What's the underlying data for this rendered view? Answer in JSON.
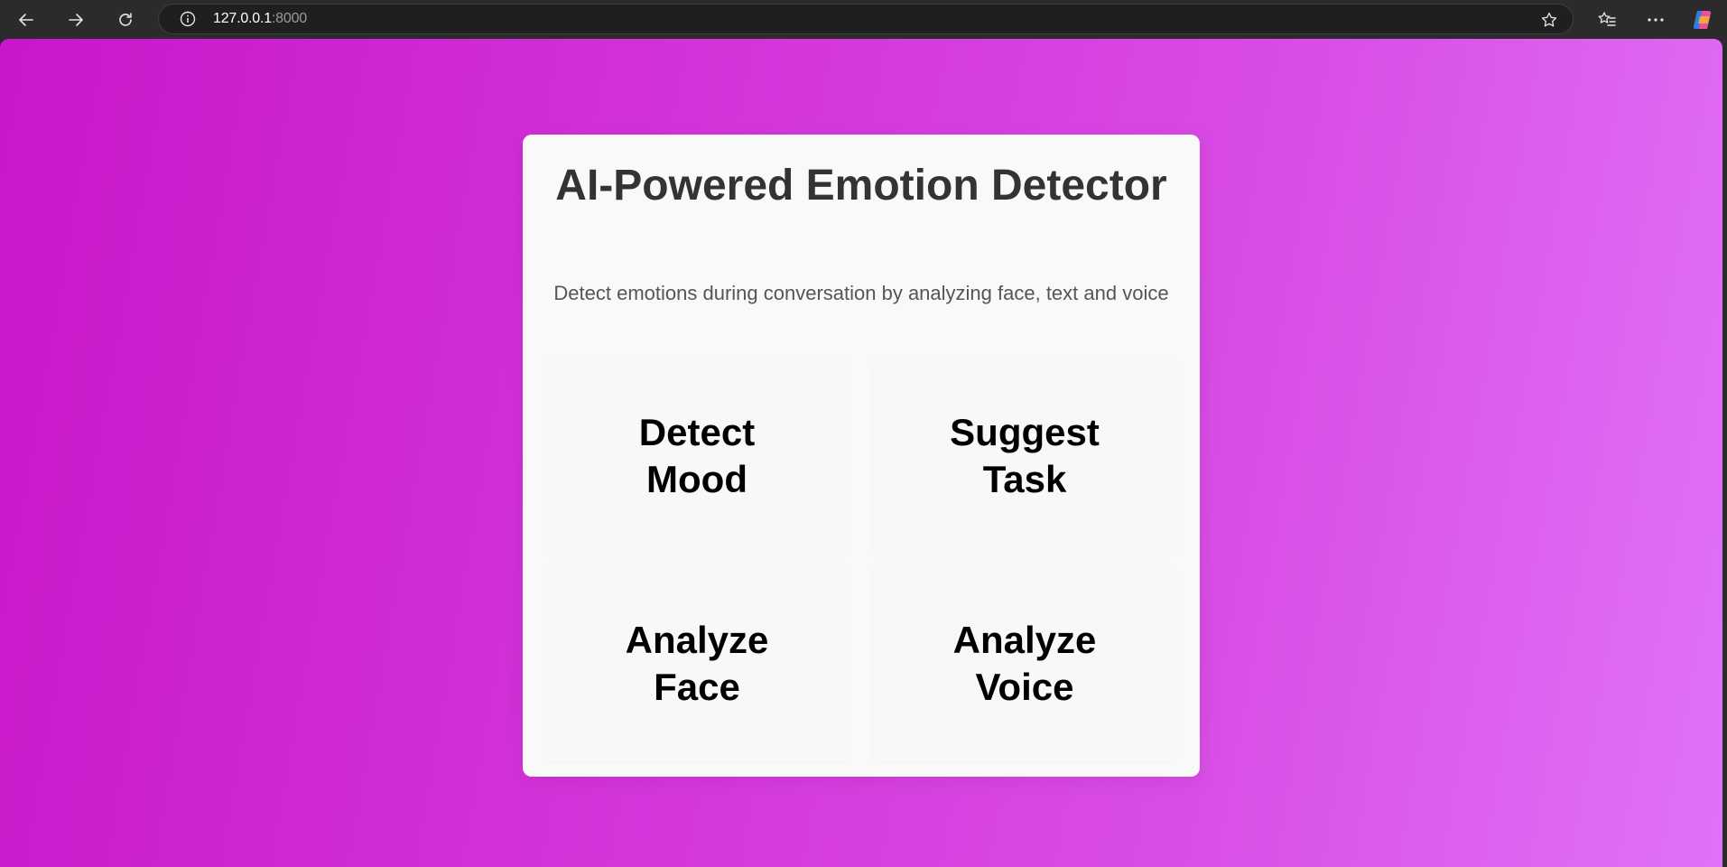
{
  "browser": {
    "url_host": "127.0.0.1",
    "url_port": ":8000"
  },
  "main": {
    "title": "AI-Powered Emotion Detector",
    "subtitle": "Detect emotions during conversation by analyzing face, text and voice",
    "tiles": [
      {
        "label": "Detect Mood"
      },
      {
        "label": "Suggest Task"
      },
      {
        "label": "Analyze Face"
      },
      {
        "label": "Analyze Voice"
      }
    ]
  },
  "colors": {
    "gradient_start": "#c916c9",
    "gradient_end": "#df72f6",
    "card_bg": "#f9f9f9",
    "title": "#333333"
  },
  "icons": [
    "back-arrow-icon",
    "forward-arrow-icon",
    "reload-icon",
    "info-icon",
    "star-icon",
    "favorites-icon",
    "more-icon",
    "copilot-icon"
  ]
}
